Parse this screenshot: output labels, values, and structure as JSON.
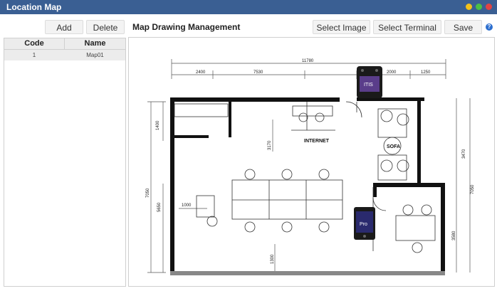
{
  "window": {
    "title": "Location Map",
    "controls": {
      "minimize_color": "#f3c11a",
      "maximize_color": "#4bbf45",
      "close_color": "#e04343"
    }
  },
  "toolbar": {
    "add_label": "Add",
    "delete_label": "Delete",
    "section_title": "Map Drawing Management",
    "select_image_label": "Select Image",
    "select_terminal_label": "Select Terminal",
    "save_label": "Save",
    "help_glyph": "?"
  },
  "map_list": {
    "columns": [
      "Code",
      "Name"
    ],
    "rows": [
      {
        "code": "1",
        "name": "Map01"
      }
    ]
  },
  "floorplan": {
    "dimensions": [
      "11780",
      "2400",
      "7530",
      "1000",
      "2000",
      "1250",
      "1400",
      "7050",
      "5650",
      "3170",
      "3470",
      "3580",
      "1000",
      "1300",
      "7050"
    ],
    "labels": {
      "internet": "INTERNET",
      "sofa": "SOFA"
    },
    "terminals": [
      {
        "name": "top-terminal",
        "screen_text": "ITIS"
      },
      {
        "name": "right-terminal",
        "screen_text": "Pro"
      }
    ]
  }
}
